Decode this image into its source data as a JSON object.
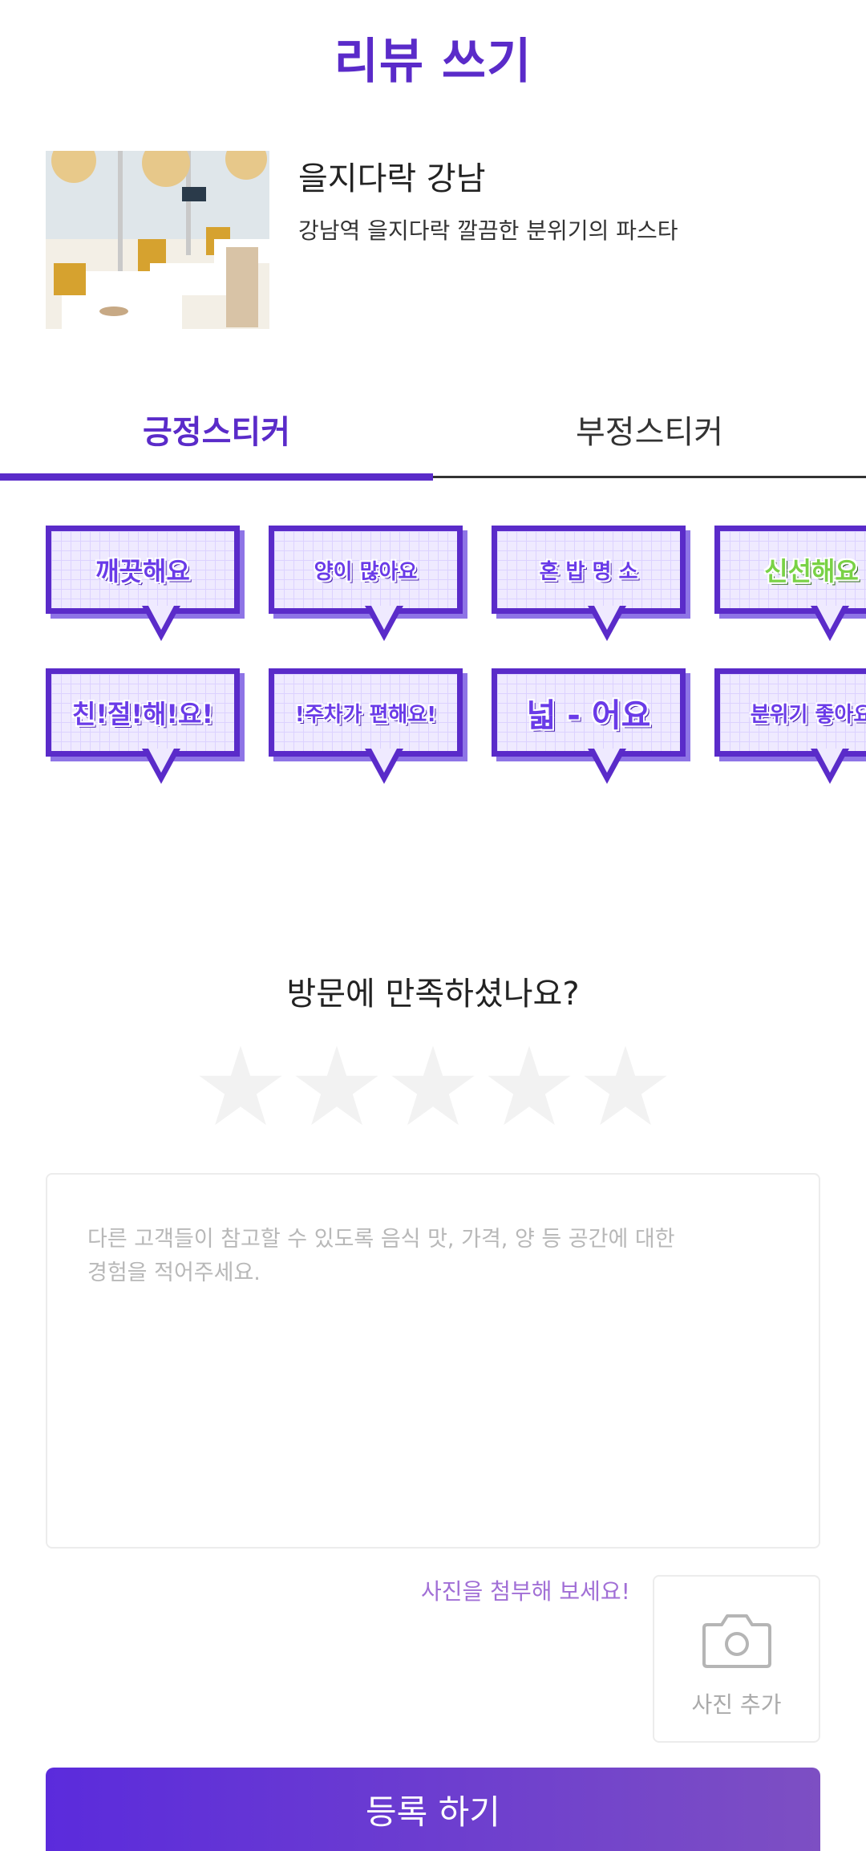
{
  "header": {
    "title": "리뷰 쓰기"
  },
  "restaurant": {
    "name": "을지다락 강남",
    "description": "강남역 을지다락 깔끔한 분위기의 파스타"
  },
  "tabs": [
    {
      "label": "긍정스티커",
      "active": true
    },
    {
      "label": "부정스티커",
      "active": false
    }
  ],
  "stickers": [
    {
      "label": "깨끗해요"
    },
    {
      "label": "양이 많아요"
    },
    {
      "label": "혼 밥 명 소"
    },
    {
      "label": "신선해요"
    },
    {
      "label": "친!절!해!요!"
    },
    {
      "label": "!주차가 편해요!"
    },
    {
      "label": "넓 - 어요"
    },
    {
      "label": "분위기 좋아요"
    }
  ],
  "rating": {
    "question": "방문에 만족하셨나요?",
    "value": 0,
    "max": 5
  },
  "review": {
    "placeholder": "다른 고객들이 참고할 수 있도록 음식 맛, 가격, 양 등 공간에 대한\n경험을 적어주세요.",
    "value": ""
  },
  "photo": {
    "hint": "사진을 첨부해 보세요!",
    "button_label": "사진 추가"
  },
  "submit": {
    "label": "등록 하기"
  },
  "colors": {
    "accent": "#5a2bc9",
    "star_empty": "#f2f2f2",
    "hint": "#a16fd6"
  }
}
